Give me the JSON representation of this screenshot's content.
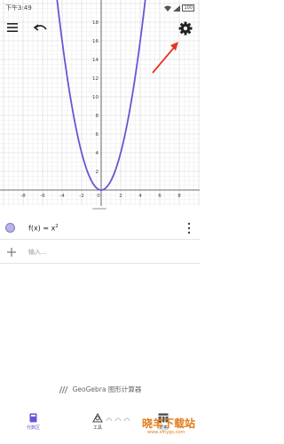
{
  "status_bar": {
    "time": "下午3:49",
    "battery": "100"
  },
  "graph": {
    "function_expr": "x^2",
    "x_ticks": [
      "-8",
      "-6",
      "-4",
      "-2",
      "0",
      "2",
      "4",
      "6",
      "8"
    ],
    "y_ticks": [
      "2",
      "4",
      "6",
      "8",
      "10",
      "12",
      "14",
      "16",
      "18"
    ],
    "x_range": [
      -10,
      10
    ],
    "y_range": [
      -1.5,
      18.5
    ],
    "curve_color": "#6557d2"
  },
  "algebra": {
    "row1_expr": "f(x) = x",
    "row1_exp": "2",
    "input_placeholder": "输入..."
  },
  "brand": {
    "name": "GeoGebra 图形计算器"
  },
  "tabs": [
    {
      "label": "代数区",
      "icon": "algebra-tab-icon",
      "active": true
    },
    {
      "label": "工具",
      "icon": "tools-tab-icon",
      "active": false
    },
    {
      "label": "表格",
      "icon": "table-tab-icon",
      "active": false
    }
  ],
  "watermark": {
    "text": "晓羊下载站",
    "sub": "www.xfhygs.com"
  },
  "colors": {
    "accent": "#6557d2",
    "annotation": "#e53424",
    "watermark": "#e07b1b"
  }
}
